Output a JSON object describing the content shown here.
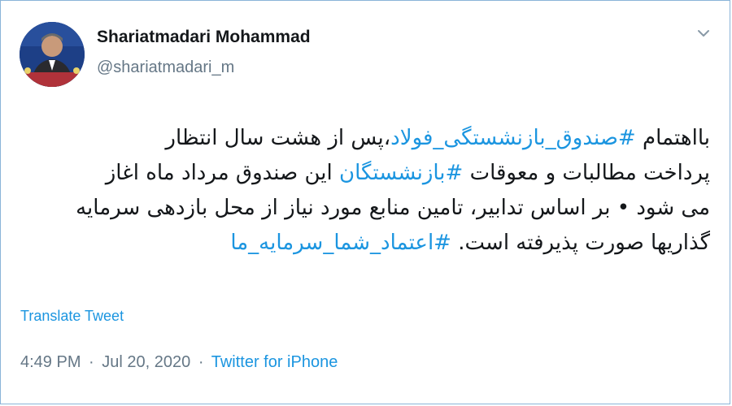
{
  "author": {
    "name": "Shariatmadari Mohammad",
    "handle": "@shariatmadari_m"
  },
  "tweet": {
    "line1": {
      "pre": "بااهتمام ",
      "hashtag": "#صندوق_بازنشستگی_فولاد",
      "post": "،پس از هشت سال انتظار"
    },
    "line2": {
      "pre": "پرداخت مطالبات و معوقات ",
      "hashtag": "#بازنشستگان",
      "post": " این صندوق مرداد ماه اغاز"
    },
    "line3": "می شود • بر اساس تدابیر، تامین منابع مورد نیاز  از محل بازدهی سرمایه",
    "line4": {
      "pre": "گذاریها صورت پذیرفته است. ",
      "hashtag": "#اعتماد_شما_سرمایه_ما"
    }
  },
  "translate_label": "Translate Tweet",
  "meta": {
    "time": "4:49 PM",
    "dot1": "·",
    "date": "Jul 20, 2020",
    "dot2": "·",
    "source": "Twitter for iPhone"
  },
  "colors": {
    "link": "#1b95e0",
    "secondary_text": "#657786",
    "primary_text": "#14171a"
  },
  "icons": {
    "menu": "chevron-down-icon"
  }
}
